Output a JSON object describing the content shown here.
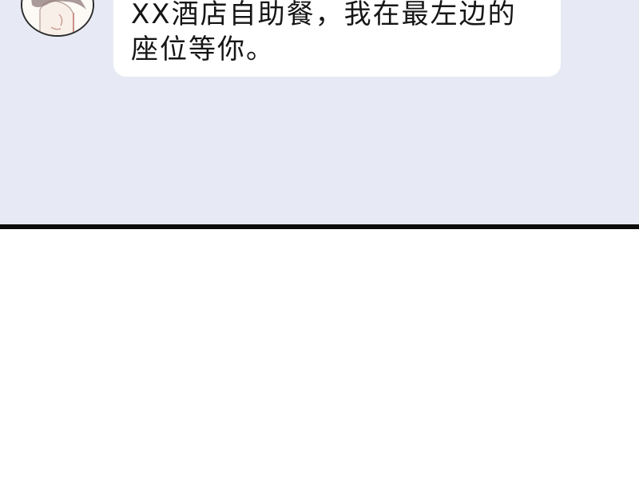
{
  "chat": {
    "message": {
      "text": "XX酒店自助餐，我在最左边的座位等你。"
    },
    "avatar": {
      "icon": "character-portrait-icon"
    }
  },
  "colors": {
    "chat_background": "#e7eaf5",
    "bubble_background": "#ffffff",
    "divider": "#0d0d0d",
    "lower_background": "#ffffff"
  }
}
